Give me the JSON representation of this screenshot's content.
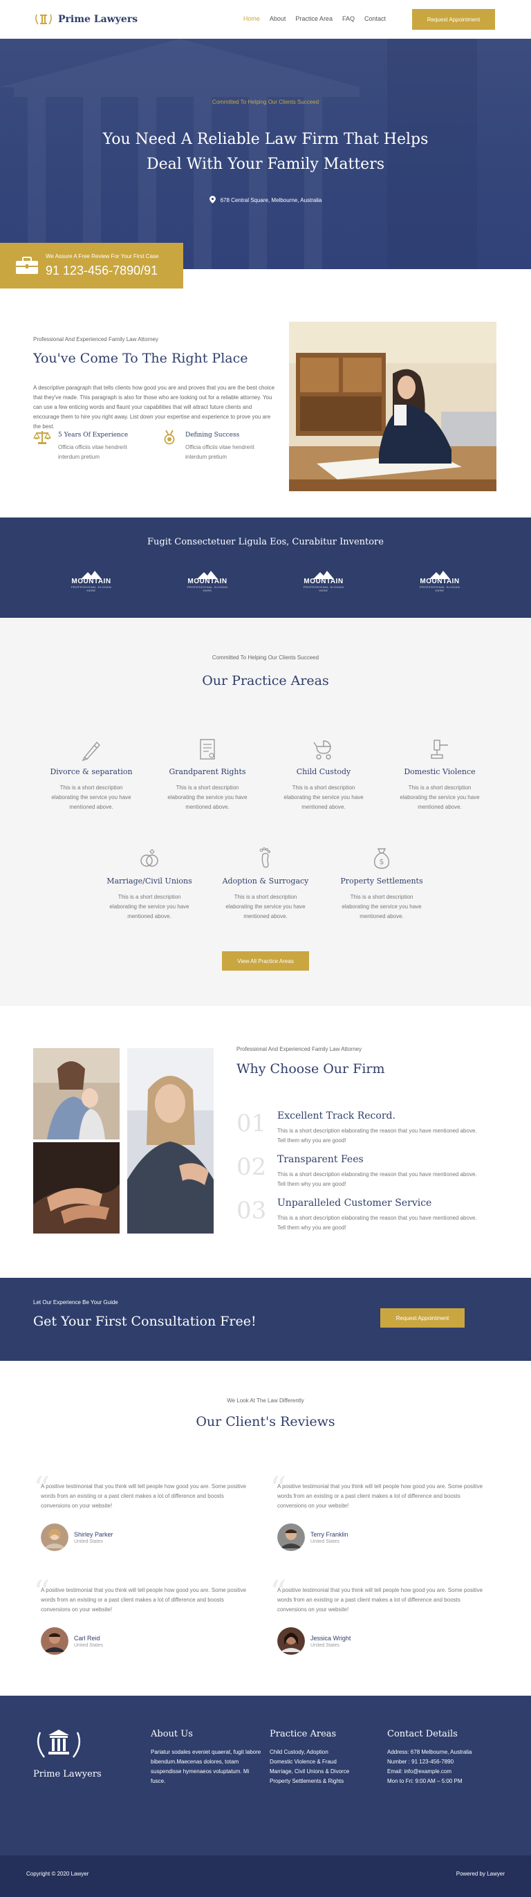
{
  "brand": {
    "name": "Prime Lawyers"
  },
  "nav": {
    "items": [
      "Home",
      "About",
      "Practice Area",
      "FAQ",
      "Contact"
    ],
    "cta": "Request Appointment"
  },
  "hero": {
    "tagline": "Committed To Helping Our Clients Succeed",
    "title_line1": "You Need A Reliable Law Firm That Helps",
    "title_line2": "Deal With Your Family Matters",
    "address": "678 Central Square, Melbourne, Australia",
    "promo_text": "We Assure A Free Review For Your First Case",
    "promo_phone": "91 123-456-7890/91"
  },
  "about": {
    "kicker": "Professional And Experienced Family Law Attorney",
    "title": "You've Come To The Right Place",
    "description": "A descriptive paragraph that tells clients how good you are and proves that you are the best choice that they've made. This paragraph is also for those who are looking out for a reliable attorney. You can use a few enticing words and flaunt your capabilities that will attract future clients and encourage them to hire you right away. List down your expertise and experience to prove you are the best.",
    "features": [
      {
        "title": "5 Years Of Experience",
        "desc": "Officia officiis vitae hendrerit interdum pretium"
      },
      {
        "title": "Defining Success",
        "desc": "Officia officiis vitae hendrerit interdum pretium"
      }
    ]
  },
  "logos": {
    "title": "Fugit Consectetuer Ligula Eos, Curabitur Inventore",
    "items": [
      {
        "name": "MOUNTAIN",
        "sub": "PROFESSIONAL SLOGAN HERE"
      },
      {
        "name": "MOUNTAIN",
        "sub": "PROFESSIONAL SLOGAN HERE"
      },
      {
        "name": "MOUNTAIN",
        "sub": "PROFESSIONAL SLOGAN HERE"
      },
      {
        "name": "MOUNTAIN",
        "sub": "PROFESSIONAL SLOGAN HERE"
      }
    ]
  },
  "practice": {
    "kicker": "Committed To Helping Our Clients Succeed",
    "title": "Our Practice Areas",
    "areas": [
      {
        "title": "Divorce & separation",
        "desc": "This is a short description elaborating the service you have mentioned above.",
        "icon": "pen-icon"
      },
      {
        "title": "Grandparent Rights",
        "desc": "This is a short description elaborating the service you have mentioned above.",
        "icon": "document-icon"
      },
      {
        "title": "Child Custody",
        "desc": "This is a short description elaborating the service you have mentioned above.",
        "icon": "stroller-icon"
      },
      {
        "title": "Domestic Violence",
        "desc": "This is a short description elaborating the service you have mentioned above.",
        "icon": "gavel-icon"
      },
      {
        "title": "Marriage/Civil Unions",
        "desc": "This is a short description elaborating the service you have mentioned above.",
        "icon": "rings-icon"
      },
      {
        "title": "Adoption & Surrogacy",
        "desc": "This is a short description elaborating the service you have mentioned above.",
        "icon": "footprint-icon"
      },
      {
        "title": "Property Settlements",
        "desc": "This is a short description elaborating the service you have mentioned above.",
        "icon": "money-bag-icon"
      }
    ],
    "button": "View All Practice Areas"
  },
  "why": {
    "kicker": "Professional And Experienced Family Law Attorney",
    "title": "Why Choose Our Firm",
    "reasons": [
      {
        "num": "01",
        "title": "Excellent Track Record.",
        "desc": "This is a short description elaborating the reason that you have mentioned above. Tell them why you are good!"
      },
      {
        "num": "02",
        "title": "Transparent Fees",
        "desc": "This is a short description elaborating the reason that you have mentioned above. Tell them why you are good!"
      },
      {
        "num": "03",
        "title": "Unparalleled Customer Service",
        "desc": "This is a short description elaborating the reason that you have mentioned above. Tell them why you are good!"
      }
    ]
  },
  "cta": {
    "kicker": "Let Our Experience Be Your Guide",
    "title": "Get Your First Consultation Free!",
    "button": "Request Appointment"
  },
  "reviews": {
    "kicker": "We Look At The Law Differently",
    "title": "Our Client's Reviews",
    "items": [
      {
        "text": "A positive testimonial that you think will tell people how good you are. Some positive words from an existing or a past client makes a lot of difference and boosts conversions on your website!",
        "name": "Shirley Parker",
        "location": "United States"
      },
      {
        "text": "A positive testimonial that you think will tell people how good you are. Some positive words from an existing or a past client makes a lot of difference and boosts conversions on your website!",
        "name": "Terry Franklin",
        "location": "United States"
      },
      {
        "text": "A positive testimonial that you think will tell people how good you are. Some positive words from an existing or a past client makes a lot of difference and boosts conversions on your website!",
        "name": "Carl Reid",
        "location": "United States"
      },
      {
        "text": "A positive testimonial that you think will tell people how good you are. Some positive words from an existing or a past client makes a lot of difference and boosts conversions on your website!",
        "name": "Jessica Wright",
        "location": "United States"
      }
    ]
  },
  "footer": {
    "brand": "Prime Lawyers",
    "about_title": "About Us",
    "about_text": "Pariatur sodales eveniet quaerat, fugit labore bibendum.Maecenas dolores, totam suspendisse hymenaeos voluptatum. Mi fusce.",
    "practice_title": "Practice Areas",
    "practice_links": [
      "Child Custody, Adoption",
      "Domestic Violence & Fraud",
      "Marriage, Civil Unions & Divorce",
      "Property Settlements & Rights"
    ],
    "contact_title": "Contact Details",
    "contact_lines": [
      "Address: 678 Melbourne, Australia",
      "Number : 91 123-456-7890",
      "Email: info@example.com",
      "Mon to Fri: 9:00 AM – 5:00 PM"
    ],
    "copyright": "Copyright © 2020 Lawyer",
    "powered": "Powered by Lawyer"
  },
  "colors": {
    "navy": "#2f3e6b",
    "gold": "#c9a640",
    "light_gray": "#f5f5f5"
  }
}
